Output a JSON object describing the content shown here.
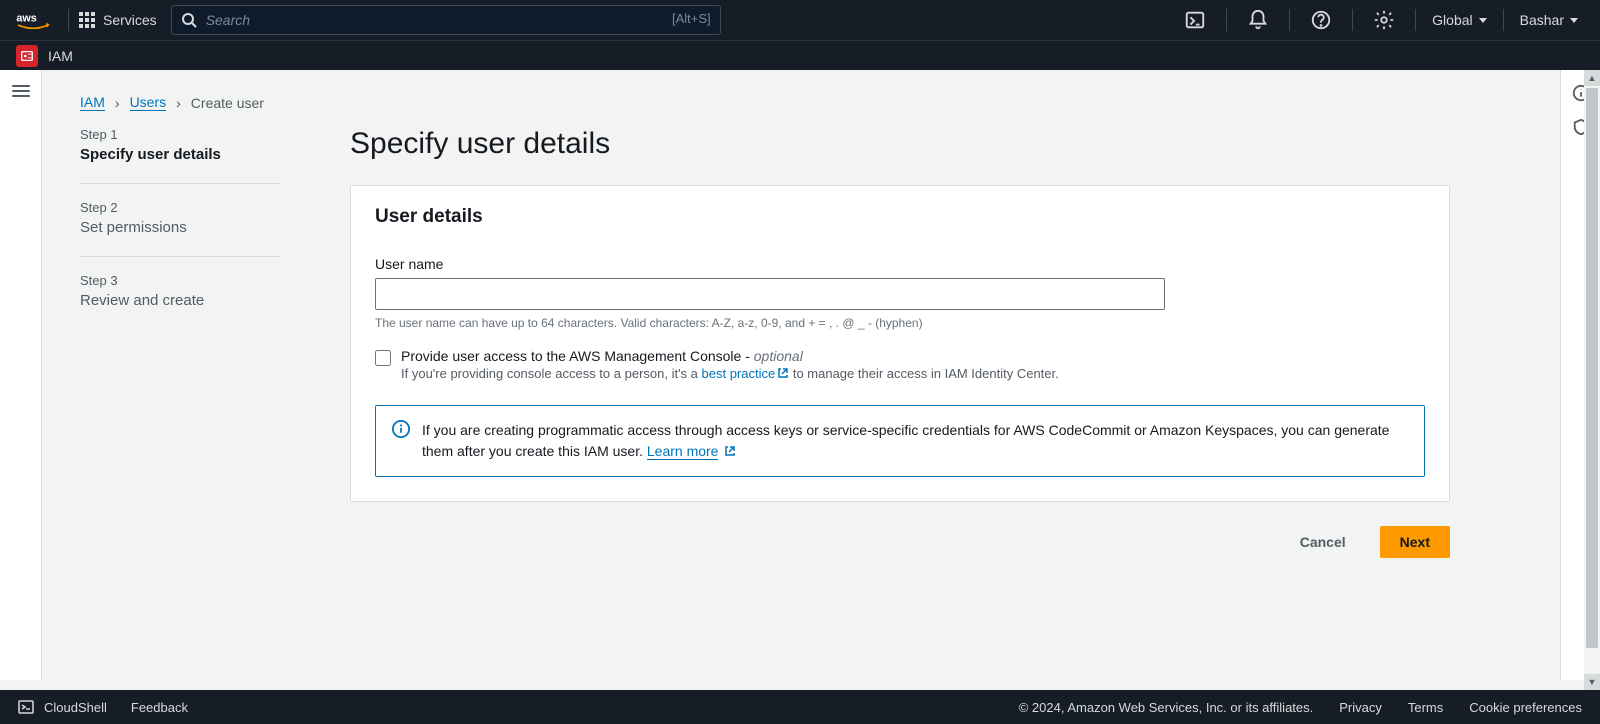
{
  "nav": {
    "services_label": "Services",
    "search_placeholder": "Search",
    "search_hint": "[Alt+S]",
    "region": "Global",
    "user": "Bashar"
  },
  "service": {
    "name": "IAM"
  },
  "breadcrumb": {
    "iam": "IAM",
    "users": "Users",
    "create_user": "Create user"
  },
  "steps": [
    {
      "num": "Step 1",
      "title": "Specify user details"
    },
    {
      "num": "Step 2",
      "title": "Set permissions"
    },
    {
      "num": "Step 3",
      "title": "Review and create"
    }
  ],
  "page": {
    "title": "Specify user details",
    "panel_title": "User details",
    "username_label": "User name",
    "username_value": "",
    "username_hint": "The user name can have up to 64 characters. Valid characters: A-Z, a-z, 0-9, and + = , . @ _ - (hyphen)",
    "console_access_label": "Provide user access to the AWS Management Console - ",
    "optional": "optional",
    "console_sub_prefix": "If you're providing console access to a person, it's a ",
    "best_practice": "best practice",
    "console_sub_suffix": " to manage their access in IAM Identity Center.",
    "info_text": "If you are creating programmatic access through access keys or service-specific credentials for AWS CodeCommit or Amazon Keyspaces, you can generate them after you create this IAM user. ",
    "learn_more": "Learn more"
  },
  "actions": {
    "cancel": "Cancel",
    "next": "Next"
  },
  "footer": {
    "cloudshell": "CloudShell",
    "feedback": "Feedback",
    "copyright": "© 2024, Amazon Web Services, Inc. or its affiliates.",
    "privacy": "Privacy",
    "terms": "Terms",
    "cookies": "Cookie preferences"
  }
}
